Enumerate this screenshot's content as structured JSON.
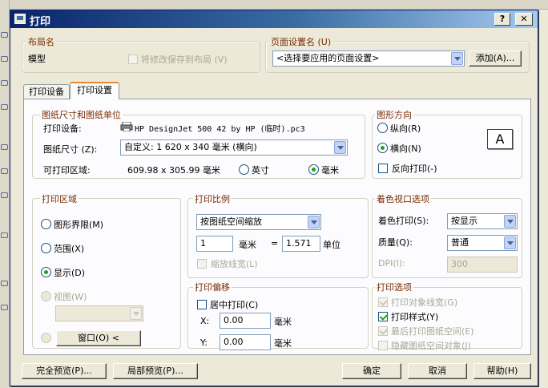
{
  "window": {
    "title": "打印",
    "help_btn": "?",
    "close_btn": "✕"
  },
  "layout": {
    "group_label": "布局名",
    "name": "模型",
    "save_changes": "将修改保存到布局",
    "save_changes_key": "(V)"
  },
  "page_setup": {
    "group_label": "页面设置名",
    "group_key": "(U)",
    "selected": "<选择要应用的页面设置>",
    "add_btn": "添加(A)..."
  },
  "tabs": [
    {
      "label": "打印设备"
    },
    {
      "label": "打印设置"
    }
  ],
  "paper": {
    "group_label": "图纸尺寸和图纸单位",
    "device_label": "打印设备:",
    "device_value": "HP DesignJet 500 42 by HP (临时).pc3",
    "size_label": "图纸尺寸",
    "size_key": "(Z):",
    "size_value": "自定义: 1  620  x  340 毫米 (横向)",
    "area_label": "可打印区域:",
    "area_value": "609.98 x 305.99 毫米",
    "unit_inch": "英寸",
    "unit_mm": "毫米"
  },
  "orientation": {
    "group_label": "图形方向",
    "portrait": "纵向(R)",
    "landscape": "横向(N)",
    "reverse": "反向打印(-)",
    "preview_letter": "A"
  },
  "print_area": {
    "group_label": "打印区域",
    "limits": "图形界限(M)",
    "extents": "范围(X)",
    "display": "显示(D)",
    "view": "视图(W)",
    "window_btn": "窗口(O) <"
  },
  "scale": {
    "group_label": "打印比例",
    "selected": "按图纸空间缩放",
    "value1": "1",
    "unit": "毫米",
    "equals": "=",
    "value2": "1.571",
    "unit2": "单位",
    "lineweight": "缩放线宽(L)"
  },
  "shade": {
    "group_label": "着色视口选项",
    "shade_label": "着色打印(S):",
    "shade_value": "按显示",
    "quality_label": "质量(Q):",
    "quality_value": "普通",
    "dpi_label": "DPI(I):",
    "dpi_value": "300"
  },
  "offset": {
    "group_label": "打印偏移",
    "center": "居中打印(C)",
    "x_label": "X:",
    "x_value": "0.00",
    "y_label": "Y:",
    "y_value": "0.00",
    "unit": "毫米"
  },
  "options": {
    "group_label": "打印选项",
    "lineweights": "打印对象线宽(G)",
    "styles": "打印样式(Y)",
    "paperspace_last": "最后打印图纸空间(E)",
    "hide": "隐藏图纸空间对象(J)"
  },
  "footer": {
    "full_preview": "完全预览(P)...",
    "partial_preview": "局部预览(P)...",
    "ok": "确定",
    "cancel": "取消",
    "help": "帮助(H)"
  }
}
